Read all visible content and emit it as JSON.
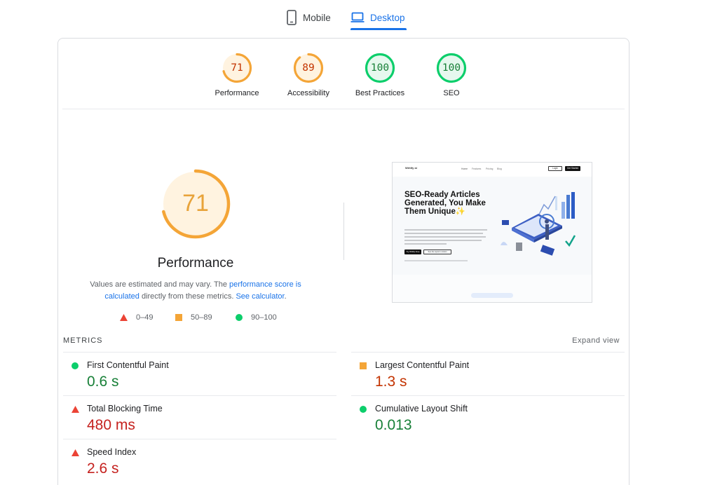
{
  "tabs": [
    {
      "label": "Mobile",
      "icon": "phone-icon"
    },
    {
      "label": "Desktop",
      "icon": "laptop-icon",
      "selected": true
    }
  ],
  "categories": [
    {
      "label": "Performance",
      "score": "71",
      "status": "average",
      "color": "#e8a33a"
    },
    {
      "label": "Accessibility",
      "score": "89",
      "status": "average",
      "color": "#e8a33a"
    },
    {
      "label": "Best Practices",
      "score": "100",
      "status": "pass",
      "color": "#0cce6b"
    },
    {
      "label": "SEO",
      "score": "100",
      "status": "pass",
      "color": "#0cce6b"
    }
  ],
  "performance": {
    "score": "71",
    "title": "Performance",
    "note_a": "Values are estimated and may vary. The ",
    "note_link1": "performance score is calculated",
    "note_b": " directly from these metrics. ",
    "note_link2": "See calculator",
    "note_c": "."
  },
  "legend": [
    {
      "range": "0–49",
      "shape": "triangle",
      "color": "#eb4335"
    },
    {
      "range": "50–89",
      "shape": "square",
      "color": "#f4a537"
    },
    {
      "range": "90–100",
      "shape": "circle",
      "color": "#0cce6b"
    }
  ],
  "screenshot": {
    "logo": "Writify ai",
    "nav": [
      "Home",
      "Features",
      "Pricing",
      "Blog"
    ],
    "login": "Login",
    "cta": "Get Started",
    "headline": "SEO-Ready Articles Generated, You Make Them Unique✨",
    "button1": "Try Writify Free",
    "button2": "See the report in Action"
  },
  "metrics": {
    "heading": "METRICS",
    "expand_label": "Expand view",
    "items": [
      {
        "name": "First Contentful Paint",
        "value": "0.6 s",
        "status": "pass"
      },
      {
        "name": "Largest Contentful Paint",
        "value": "1.3 s",
        "status": "average"
      },
      {
        "name": "Total Blocking Time",
        "value": "480 ms",
        "status": "fail"
      },
      {
        "name": "Cumulative Layout Shift",
        "value": "0.013",
        "status": "pass"
      },
      {
        "name": "Speed Index",
        "value": "2.6 s",
        "status": "fail"
      }
    ]
  },
  "colors": {
    "accent": "#1a73e8",
    "pass": "#0cce6b",
    "average": "#f4a537",
    "fail": "#eb4335"
  }
}
